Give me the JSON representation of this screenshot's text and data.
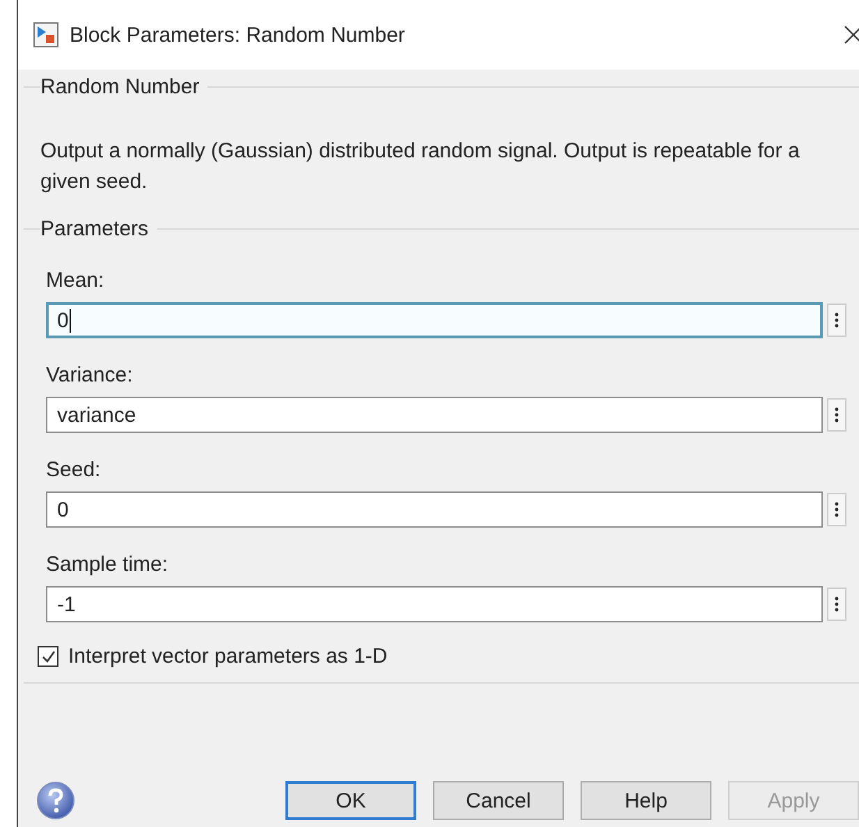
{
  "window": {
    "title": "Block Parameters: Random Number"
  },
  "block": {
    "title": "Random Number",
    "description": "Output a normally (Gaussian) distributed random signal.  Output is repeatable for a given seed."
  },
  "parameters": {
    "title": "Parameters",
    "fields": [
      {
        "label": "Mean:",
        "value": "0",
        "focused": true
      },
      {
        "label": "Variance:",
        "value": "variance",
        "focused": false
      },
      {
        "label": "Seed:",
        "value": "0",
        "focused": false
      },
      {
        "label": "Sample time:",
        "value": "-1",
        "focused": false
      }
    ],
    "checkbox": {
      "label": "Interpret vector parameters as 1-D",
      "checked": true
    }
  },
  "buttons": [
    {
      "label": "OK",
      "focused": true,
      "disabled": false
    },
    {
      "label": "Cancel",
      "focused": false,
      "disabled": false
    },
    {
      "label": "Help",
      "focused": false,
      "disabled": false
    },
    {
      "label": "Apply",
      "focused": false,
      "disabled": true
    }
  ]
}
